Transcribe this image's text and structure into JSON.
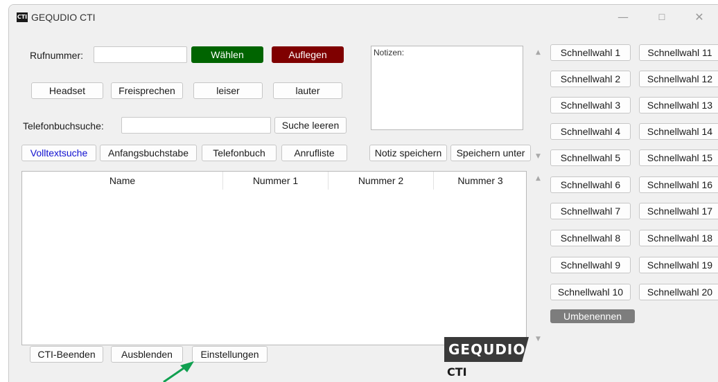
{
  "window": {
    "title": "GEQUDIO CTI",
    "logo_text": "CTI",
    "controls": {
      "minimize": "—",
      "maximize": "☐",
      "close": "✕"
    }
  },
  "dial": {
    "number_label": "Rufnummer:",
    "number_value": "",
    "dial_button": "Wählen",
    "hangup_button": "Auflegen"
  },
  "audio": {
    "headset": "Headset",
    "speaker": "Freisprechen",
    "quieter": "leiser",
    "louder": "lauter"
  },
  "phonebook_search": {
    "label": "Telefonbuchsuche:",
    "value": "",
    "clear_button": "Suche leeren"
  },
  "search_tabs": [
    "Volltextsuche",
    "Anfangsbuchstabe",
    "Telefonbuch",
    "Anrufliste"
  ],
  "notes": {
    "label": "Notizen:",
    "save_button": "Notiz speichern",
    "save_as_button": "Speichern unter"
  },
  "table": {
    "columns": [
      "Name",
      "Nummer 1",
      "Nummer 2",
      "Nummer 3"
    ],
    "rows": []
  },
  "speed_dial": {
    "left": [
      "Schnellwahl 1",
      "Schnellwahl 2",
      "Schnellwahl 3",
      "Schnellwahl 4",
      "Schnellwahl 5",
      "Schnellwahl 6",
      "Schnellwahl 7",
      "Schnellwahl 8",
      "Schnellwahl 9",
      "Schnellwahl 10"
    ],
    "right": [
      "Schnellwahl 11",
      "Schnellwahl 12",
      "Schnellwahl 13",
      "Schnellwahl 14",
      "Schnellwahl 15",
      "Schnellwahl 16",
      "Schnellwahl 17",
      "Schnellwahl 18",
      "Schnellwahl 19",
      "Schnellwahl 20"
    ],
    "rename_button": "Umbenennen"
  },
  "footer": {
    "exit_button": "CTI-Beenden",
    "hide_button": "Ausblenden",
    "settings_button": "Einstellungen",
    "brand_name": "GEQUDIO",
    "brand_sub": "CTI"
  },
  "colors": {
    "dial_green": "#006400",
    "hangup_red": "#7f0000",
    "active_tab_blue": "#1010d0",
    "annotation_arrow": "#10a050"
  },
  "icons": {
    "scroll_up": "▲",
    "scroll_down": "▼"
  }
}
